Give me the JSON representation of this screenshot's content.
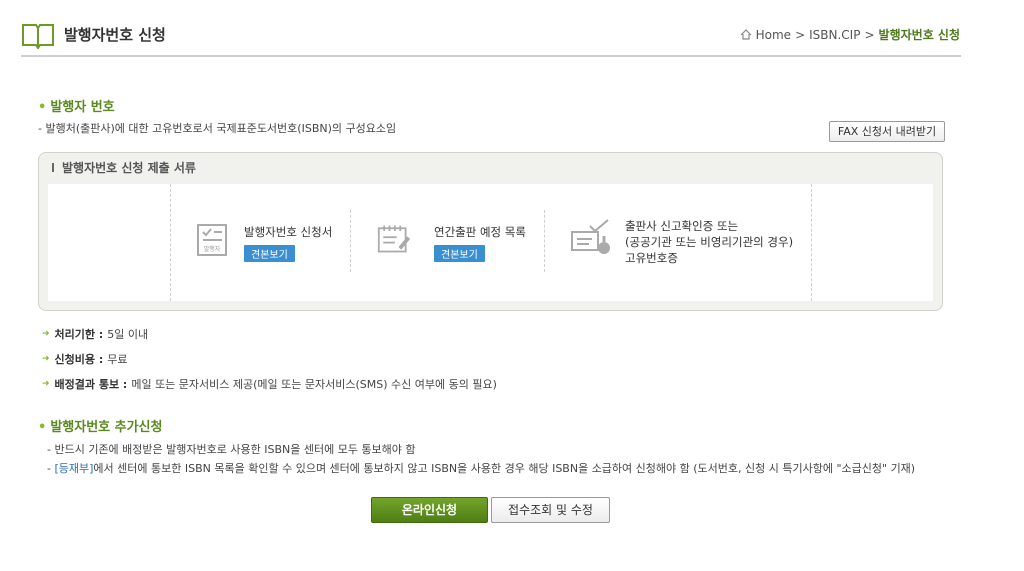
{
  "header": {
    "title": "발행자번호 신청",
    "breadcrumb": {
      "home": "Home",
      "sep1": ">",
      "level1": "ISBN.CIP",
      "sep2": ">",
      "current": "발행자번호 신청"
    }
  },
  "publisher_number": {
    "title": "발행자 번호",
    "description": "- 발행처(출판사)에 대한 고유번호로서 국제표준도서번호(ISBN)의 구성요소임",
    "fax_button": "FAX 신청서 내려받기"
  },
  "documents": {
    "box_title": "발행자번호 신청 제출 서류",
    "items": [
      {
        "label": "발행자번호 신청서",
        "badge": "견본보기",
        "icon": "application-form-icon",
        "icon_text": "발행자"
      },
      {
        "label": "연간출판 예정 목록",
        "badge": "견본보기",
        "icon": "calendar-list-icon"
      },
      {
        "label_line1": "출판사 신고확인증 또는",
        "label_line2": "(공공기관 또는 비영리기관의 경우)",
        "label_line3": "고유번호증",
        "icon": "certificate-stamp-icon"
      }
    ]
  },
  "info": [
    {
      "label": "처리기한 :",
      "value": "5일 이내"
    },
    {
      "label": "신청비용 :",
      "value": "무료"
    },
    {
      "label": "배정결과 통보 :",
      "value": "메일 또는 문자서비스 제공(메일 또는 문자서비스(SMS) 수신 여부에 동의 필요)"
    }
  ],
  "additional": {
    "title": "발행자번호 추가신청",
    "line1": "- 반드시 기존에 배정받은 발행자번호로 사용한 ISBN을 센터에 모두 통보해야 함",
    "line2_prefix": "- ",
    "line2_link": "[등재부]",
    "line2_rest": "에서 센터에 통보한 ISBN 목록을 확인할 수 있으며 센터에 통보하지 않고 ISBN을 사용한 경우 해당 ISBN을 소급하여 신청해야 함 (도서번호, 신청 시 특기사항에 \"소급신청\" 기재)"
  },
  "buttons": {
    "online_apply": "온라인신청",
    "check_modify": "접수조회 및 수정"
  },
  "colors": {
    "accent_green": "#5a8a1e",
    "button_green": "#5f9120",
    "badge_blue": "#3a8fd0",
    "link_blue": "#2a6fb5"
  }
}
